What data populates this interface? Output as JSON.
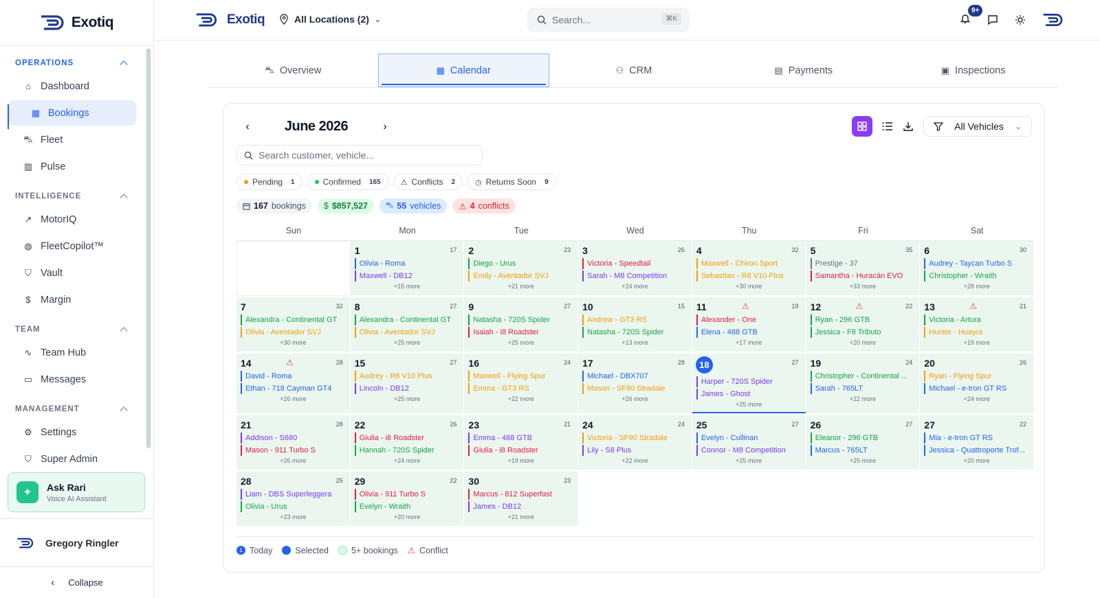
{
  "app": {
    "brand": "Exotiq"
  },
  "sidebar": {
    "sections": [
      {
        "title": "OPERATIONS",
        "items": [
          "Dashboard",
          "Bookings",
          "Fleet",
          "Pulse"
        ]
      },
      {
        "title": "INTELLIGENCE",
        "items": [
          "MotorIQ",
          "FleetCopilot™",
          "Vault",
          "Margin"
        ]
      },
      {
        "title": "TEAM",
        "items": [
          "Team Hub",
          "Messages"
        ]
      },
      {
        "title": "MANAGEMENT",
        "items": [
          "Settings",
          "Super Admin"
        ]
      }
    ],
    "active_item": "Bookings",
    "ask": {
      "title": "Ask Rari",
      "subtitle": "Voice AI Assistant"
    },
    "user": "Gregory Ringler",
    "collapse": "Collapse"
  },
  "topbar": {
    "location": "All Locations (2)",
    "search_placeholder": "Search...",
    "shortcut": "⌘K",
    "notif_badge": "9+"
  },
  "tabs": [
    "Overview",
    "Calendar",
    "CRM",
    "Payments",
    "Inspections"
  ],
  "active_tab": "Calendar",
  "calendar": {
    "month": "June 2026",
    "vehicle_filter": "All Vehicles",
    "search_placeholder": "Search customer, vehicle...",
    "chips": [
      {
        "label": "Pending",
        "count": "1",
        "color": "#f59e0b"
      },
      {
        "label": "Confirmed",
        "count": "165",
        "color": "#22c55e"
      },
      {
        "label": "Conflicts",
        "count": "2"
      },
      {
        "label": "Returns Soon",
        "count": "9"
      }
    ],
    "stats": {
      "bookings_num": "167",
      "bookings_label": "bookings",
      "revenue": "$857,527",
      "vehicles_num": "55",
      "vehicles_label": "vehicles",
      "conflicts_num": "4",
      "conflicts_label": "conflicts"
    },
    "weekdays": [
      "Sun",
      "Mon",
      "Tue",
      "Wed",
      "Thu",
      "Fri",
      "Sat"
    ],
    "days": [
      {
        "d": "1",
        "c": "17",
        "b": [
          [
            "Olivia - Roma",
            "#2563eb"
          ],
          [
            "Maxwell - DB12",
            "#7c3aed"
          ]
        ],
        "m": "+15 more"
      },
      {
        "d": "2",
        "c": "23",
        "b": [
          [
            "Diego - Urus",
            "#16a34a"
          ],
          [
            "Emily - Aventador SVJ",
            "#f59e0b"
          ]
        ],
        "m": "+21 more"
      },
      {
        "d": "3",
        "c": "26",
        "b": [
          [
            "Victoria - Speedtail",
            "#e11d48"
          ],
          [
            "Sarah - M8 Competition",
            "#7c3aed"
          ]
        ],
        "m": "+24 more"
      },
      {
        "d": "4",
        "c": "32",
        "b": [
          [
            "Maxwell - Chiron Sport",
            "#f59e0b"
          ],
          [
            "Sebastian - R8 V10 Plus",
            "#f59e0b"
          ]
        ],
        "m": "+30 more"
      },
      {
        "d": "5",
        "c": "35",
        "b": [
          [
            "Prestige - 37",
            "#6b7280"
          ],
          [
            "Samantha - Huracán EVO",
            "#e11d48"
          ]
        ],
        "m": "+33 more"
      },
      {
        "d": "6",
        "c": "30",
        "b": [
          [
            "Audrey - Taycan Turbo S",
            "#2563eb"
          ],
          [
            "Christopher - Wraith",
            "#16a34a"
          ]
        ],
        "m": "+28 more"
      },
      {
        "d": "7",
        "c": "32",
        "b": [
          [
            "Alexandra - Continental GT",
            "#16a34a"
          ],
          [
            "Olivia - Aventador SVJ",
            "#f59e0b"
          ]
        ],
        "m": "+30 more"
      },
      {
        "d": "8",
        "c": "27",
        "b": [
          [
            "Alexandra - Continental GT",
            "#16a34a"
          ],
          [
            "Olivia - Aventador SVJ",
            "#f59e0b"
          ]
        ],
        "m": "+25 more"
      },
      {
        "d": "9",
        "c": "27",
        "b": [
          [
            "Natasha - 720S Spider",
            "#16a34a"
          ],
          [
            "Isaiah - i8 Roadster",
            "#e11d48"
          ]
        ],
        "m": "+25 more"
      },
      {
        "d": "10",
        "c": "15",
        "b": [
          [
            "Andrew - GT3 RS",
            "#f59e0b"
          ],
          [
            "Natasha - 720S Spider",
            "#16a34a"
          ]
        ],
        "m": "+13 more"
      },
      {
        "d": "11",
        "c": "19",
        "w": true,
        "b": [
          [
            "Alexander - One",
            "#e11d48"
          ],
          [
            "Elena - 488 GTB",
            "#2563eb"
          ]
        ],
        "m": "+17 more"
      },
      {
        "d": "12",
        "c": "22",
        "w": true,
        "b": [
          [
            "Ryan - 296 GTB",
            "#16a34a"
          ],
          [
            "Jessica - F8 Tributo",
            "#16a34a"
          ]
        ],
        "m": "+20 more"
      },
      {
        "d": "13",
        "c": "21",
        "w": true,
        "b": [
          [
            "Victoria - Artura",
            "#16a34a"
          ],
          [
            "Hunter - Huayra",
            "#f59e0b"
          ]
        ],
        "m": "+19 more"
      },
      {
        "d": "14",
        "c": "28",
        "w": true,
        "b": [
          [
            "David - Roma",
            "#2563eb"
          ],
          [
            "Ethan - 718 Cayman GT4",
            "#2563eb"
          ]
        ],
        "m": "+26 more"
      },
      {
        "d": "15",
        "c": "27",
        "b": [
          [
            "Audrey - R8 V10 Plus",
            "#f59e0b"
          ],
          [
            "Lincoln - DB12",
            "#7c3aed"
          ]
        ],
        "m": "+25 more"
      },
      {
        "d": "16",
        "c": "24",
        "b": [
          [
            "Maxwell - Flying Spur",
            "#f59e0b"
          ],
          [
            "Emma - GT3 RS",
            "#f59e0b"
          ]
        ],
        "m": "+22 more"
      },
      {
        "d": "17",
        "c": "28",
        "b": [
          [
            "Michael - DBX707",
            "#2563eb"
          ],
          [
            "Mason - SF90 Stradale",
            "#f59e0b"
          ]
        ],
        "m": "+26 more"
      },
      {
        "d": "18",
        "c": "27",
        "today": true,
        "b": [
          [
            "Harper - 720S Spider",
            "#7c3aed"
          ],
          [
            "James - Ghost",
            "#7c3aed"
          ]
        ],
        "m": "+25 more"
      },
      {
        "d": "19",
        "c": "24",
        "b": [
          [
            "Christopher - Continental ...",
            "#16a34a"
          ],
          [
            "Sarah - 765LT",
            "#2563eb"
          ]
        ],
        "m": "+22 more"
      },
      {
        "d": "20",
        "c": "26",
        "b": [
          [
            "Ryan - Flying Spur",
            "#f59e0b"
          ],
          [
            "Michael - e-tron GT RS",
            "#2563eb"
          ]
        ],
        "m": "+24 more"
      },
      {
        "d": "21",
        "c": "28",
        "b": [
          [
            "Addison - S680",
            "#7c3aed"
          ],
          [
            "Mason - 911 Turbo S",
            "#e11d48"
          ]
        ],
        "m": "+26 more"
      },
      {
        "d": "22",
        "c": "26",
        "b": [
          [
            "Giulia - i8 Roadster",
            "#e11d48"
          ],
          [
            "Hannah - 720S Spider",
            "#16a34a"
          ]
        ],
        "m": "+24 more"
      },
      {
        "d": "23",
        "c": "21",
        "b": [
          [
            "Emma - 488 GTB",
            "#7c3aed"
          ],
          [
            "Giulia - i8 Roadster",
            "#e11d48"
          ]
        ],
        "m": "+19 more"
      },
      {
        "d": "24",
        "c": "24",
        "b": [
          [
            "Victoria - SF90 Stradale",
            "#f59e0b"
          ],
          [
            "Lily - S8 Plus",
            "#7c3aed"
          ]
        ],
        "m": "+22 more"
      },
      {
        "d": "25",
        "c": "27",
        "b": [
          [
            "Evelyn - Cullinan",
            "#2563eb"
          ],
          [
            "Connor - M8 Competition",
            "#7c3aed"
          ]
        ],
        "m": "+25 more"
      },
      {
        "d": "26",
        "c": "27",
        "b": [
          [
            "Eleanor - 296 GTB",
            "#16a34a"
          ],
          [
            "Marcus - 765LT",
            "#2563eb"
          ]
        ],
        "m": "+25 more"
      },
      {
        "d": "27",
        "c": "22",
        "b": [
          [
            "Mia - e-tron GT RS",
            "#2563eb"
          ],
          [
            "Jessica - Quattroporte Trof...",
            "#2563eb"
          ]
        ],
        "m": "+20 more"
      },
      {
        "d": "28",
        "c": "25",
        "b": [
          [
            "Liam - DBS Superleggera",
            "#7c3aed"
          ],
          [
            "Olivia - Urus",
            "#16a34a"
          ]
        ],
        "m": "+23 more"
      },
      {
        "d": "29",
        "c": "22",
        "b": [
          [
            "Olivia - 911 Turbo S",
            "#e11d48"
          ],
          [
            "Evelyn - Wraith",
            "#16a34a"
          ]
        ],
        "m": "+20 more"
      },
      {
        "d": "30",
        "c": "23",
        "b": [
          [
            "Marcus - 812 Superfast",
            "#e11d48"
          ],
          [
            "James - DB12",
            "#7c3aed"
          ]
        ],
        "m": "+21 more"
      }
    ],
    "legend": [
      "Today",
      "Selected",
      "5+ bookings",
      "Conflict"
    ]
  }
}
